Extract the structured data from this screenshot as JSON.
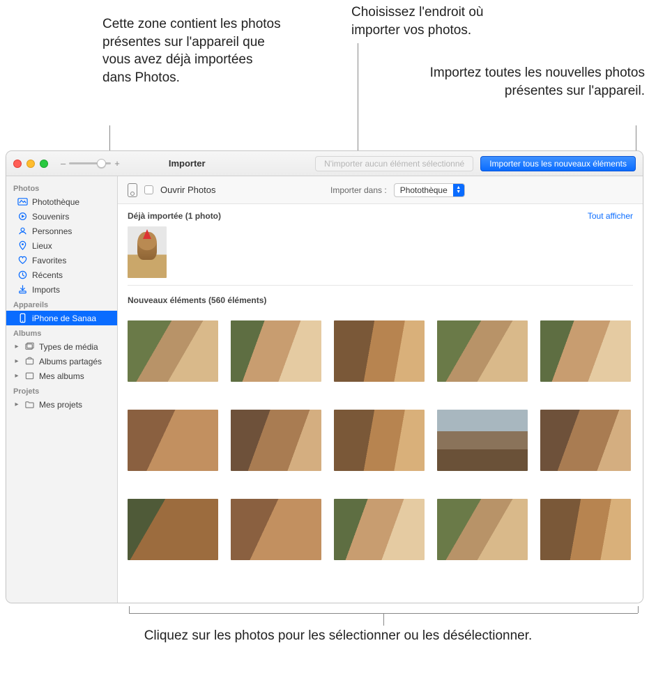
{
  "callouts": {
    "already_imported_zone": "Cette zone contient les photos présentes sur l'appareil que vous avez déjà importées dans Photos.",
    "choose_destination": "Choisissez l'endroit où importer vos photos.",
    "import_all_new": "Importez toutes les nouvelles photos présentes sur l'appareil.",
    "click_select": "Cliquez sur les photos pour les sélectionner ou les désélectionner."
  },
  "toolbar": {
    "zoom_minus": "–",
    "zoom_plus": "+",
    "title": "Importer",
    "import_selected_disabled": "N'importer aucun élément sélectionné",
    "import_all_new": "Importer tous les nouveaux éléments"
  },
  "subbar": {
    "open_photos": "Ouvrir Photos",
    "import_to_label": "Importer dans :",
    "import_to_value": "Photothèque"
  },
  "sidebar": {
    "sections": {
      "photos": "Photos",
      "devices": "Appareils",
      "albums": "Albums",
      "projects": "Projets"
    },
    "photos_items": [
      "Photothèque",
      "Souvenirs",
      "Personnes",
      "Lieux",
      "Favorites",
      "Récents",
      "Imports"
    ],
    "device_item": "iPhone de Sanaa",
    "albums_items": [
      "Types de média",
      "Albums partagés",
      "Mes albums"
    ],
    "projects_items": [
      "Mes projets"
    ]
  },
  "content": {
    "already_imported_header": "Déjà importée (1 photo)",
    "show_all": "Tout afficher",
    "new_items_header": "Nouveaux éléments (560 éléments)"
  },
  "chart_data": {
    "type": "table",
    "title": "Photos import counts",
    "rows": [
      {
        "section": "Déjà importée",
        "count": 1
      },
      {
        "section": "Nouveaux éléments",
        "count": 560
      }
    ]
  }
}
